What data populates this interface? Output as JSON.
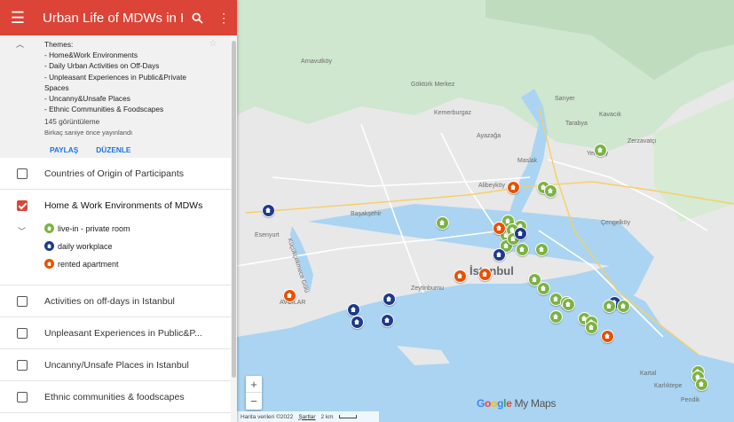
{
  "header": {
    "title": "Urban Life of MDWs in Istanbul",
    "bg": "#db4437"
  },
  "description": {
    "lines": [
      "Themes:",
      "- Home&Work Environments",
      "- Daily Urban Activities on Off-Days",
      "- Unpleasant Experiences in Public&Private",
      "Spaces",
      "- Uncanny&Unsafe Places",
      "- Ethnic Communities & Foodscapes"
    ],
    "views": "145 görüntüleme",
    "published": "Birkaç saniye önce yayınlandı",
    "share": "PAYLAŞ",
    "edit": "DÜZENLE"
  },
  "layers": [
    {
      "name": "Countries of Origin of Participants",
      "checked": false
    },
    {
      "name": "Home & Work Environments of MDWs",
      "checked": true
    },
    {
      "name": "Activities on off-days in Istanbul",
      "checked": false
    },
    {
      "name": "Unpleasant Experiences in Public&Private Spaces",
      "checked": false
    },
    {
      "name": "Uncanny/Unsafe Places in Istanbul",
      "checked": false
    },
    {
      "name": "Ethnic communities & foodscapes",
      "checked": false
    }
  ],
  "legend": [
    {
      "label": "live-in - private room",
      "color": "#7cb342"
    },
    {
      "label": "daily workplace",
      "color": "#1e3a8a"
    },
    {
      "label": "rented apartment",
      "color": "#e65100"
    }
  ],
  "icons": {
    "menu": "menu-icon",
    "search": "search-icon",
    "more": "more-vert-icon",
    "star": "star-icon"
  },
  "map": {
    "places": [
      {
        "name": "Sarıyer",
        "big": false
      },
      {
        "name": "Arnavutköy",
        "big": false
      },
      {
        "name": "Göktürk Merkez",
        "big": false
      },
      {
        "name": "Kemerburgaz",
        "big": false
      },
      {
        "name": "Ayazağa",
        "big": false
      },
      {
        "name": "Tarabya",
        "big": false
      },
      {
        "name": "Yeniköy",
        "big": false
      },
      {
        "name": "Kavacık",
        "big": false
      },
      {
        "name": "Çengelköy",
        "big": false
      },
      {
        "name": "Zerzavatçı",
        "big": false
      },
      {
        "name": "Maslak",
        "big": false
      },
      {
        "name": "Alibeyköy",
        "big": false
      },
      {
        "name": "Başakşehir",
        "big": false
      },
      {
        "name": "Esenyurt",
        "big": false
      },
      {
        "name": "Küçükçekmece Gölü",
        "big": false
      },
      {
        "name": "İstanbul",
        "big": true
      },
      {
        "name": "Zeytinburnu",
        "big": false
      },
      {
        "name": "AVCILAR",
        "big": false
      },
      {
        "name": "Kartal",
        "big": false
      },
      {
        "name": "Pendik",
        "big": false
      },
      {
        "name": "Karlıktepe",
        "big": false
      }
    ],
    "zoom_in": "+",
    "zoom_out": "−",
    "brand": "Google",
    "brand_suffix": "My Maps",
    "attribution": "Harita verileri ©2022",
    "terms": "Şartlar",
    "scale": "2 km",
    "markers": [
      {
        "type": "rented apartment"
      },
      {
        "type": "live-in - private room"
      },
      {
        "type": "live-in - private room"
      },
      {
        "type": "live-in - private room"
      },
      {
        "type": "live-in - private room"
      },
      {
        "type": "live-in - private room"
      },
      {
        "type": "live-in - private room"
      },
      {
        "type": "rented apartment"
      },
      {
        "type": "live-in - private room"
      },
      {
        "type": "live-in - private room"
      },
      {
        "type": "daily workplace"
      },
      {
        "type": "live-in - private room"
      },
      {
        "type": "live-in - private room"
      },
      {
        "type": "daily workplace"
      },
      {
        "type": "live-in - private room"
      },
      {
        "type": "daily workplace"
      },
      {
        "type": "rented apartment"
      },
      {
        "type": "rented apartment"
      },
      {
        "type": "daily workplace"
      },
      {
        "type": "rented apartment"
      },
      {
        "type": "daily workplace"
      },
      {
        "type": "daily workplace"
      },
      {
        "type": "daily workplace"
      },
      {
        "type": "live-in - private room"
      },
      {
        "type": "live-in - private room"
      },
      {
        "type": "live-in - private room"
      },
      {
        "type": "live-in - private room"
      },
      {
        "type": "live-in - private room"
      },
      {
        "type": "daily workplace"
      },
      {
        "type": "live-in - private room"
      },
      {
        "type": "live-in - private room"
      },
      {
        "type": "live-in - private room"
      },
      {
        "type": "live-in - private room"
      },
      {
        "type": "live-in - private room"
      },
      {
        "type": "rented apartment"
      },
      {
        "type": "live-in - private room"
      },
      {
        "type": "live-in - private room"
      },
      {
        "type": "live-in - private room"
      },
      {
        "type": "live-in - private room"
      },
      {
        "type": "live-in - private room"
      }
    ]
  }
}
